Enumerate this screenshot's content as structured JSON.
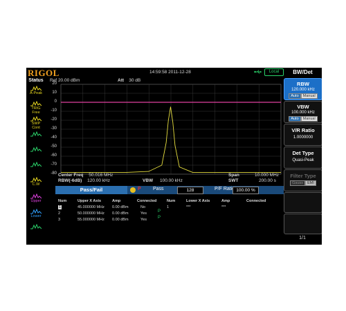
{
  "header": {
    "brand": "RIGOL",
    "clock": "14:59:58 2011-12-28",
    "remote_status": "Local"
  },
  "status": {
    "title": "Status",
    "items": [
      {
        "label": "A-Peak",
        "color": "#e8d820"
      },
      {
        "label": "TRIG",
        "value": "Free",
        "color": "#e8d820"
      },
      {
        "label": "SWP",
        "value": "Cont",
        "color": "#e8d820"
      },
      {
        "label": "",
        "color": "#2ad36a"
      },
      {
        "label": "",
        "color": "#2ad36a"
      },
      {
        "label": "",
        "color": "#2ad36a"
      },
      {
        "label": "C.W",
        "color": "#e8d820"
      },
      {
        "label": "Upper",
        "color": "#e040e0"
      },
      {
        "label": "Lower",
        "color": "#30a0ff"
      },
      {
        "label": "",
        "color": "#2ad36a"
      }
    ]
  },
  "plot": {
    "ref": "Ref",
    "ref_value": "20.00 dBm",
    "att": "Att",
    "att_value": "30 dB",
    "y_ticks": [
      "20",
      "10",
      "0",
      "-10",
      "-20",
      "-30",
      "-40",
      "-50",
      "-60",
      "-70",
      "-80"
    ],
    "upper_limit_color": "#e040a0",
    "trace_color": "#e8e040"
  },
  "chart_data": {
    "type": "line",
    "title": "",
    "xlabel": "",
    "ylabel": "",
    "ylim": [
      -80,
      20
    ],
    "xlim": [
      45.016,
      55.016
    ],
    "x_unit": "MHz",
    "y_unit": "dBm",
    "grid": true,
    "series": [
      {
        "color": "#e8e040",
        "x": [
          45.016,
          46.0,
          47.0,
          48.0,
          49.0,
          49.6,
          49.8,
          49.9,
          50.0,
          50.1,
          50.2,
          50.4,
          51.0,
          52.0,
          53.0,
          54.0,
          55.016
        ],
        "y": [
          -78,
          -78,
          -78,
          -78,
          -77,
          -70,
          -45,
          -20,
          -5,
          -22,
          -48,
          -72,
          -78,
          -78,
          -78,
          -78,
          -78
        ]
      },
      {
        "color": "#e040a0",
        "x": [
          45.016,
          55.016
        ],
        "y": [
          0,
          0
        ]
      }
    ]
  },
  "info": {
    "center_freq_label": "Center Freq",
    "center_freq": "50.016 MHz",
    "rbw_label": "RBW(-6dB)",
    "rbw": "120.00 kHz",
    "vbw_label": "VBW",
    "vbw": "100.00 kHz",
    "span_label": "Span",
    "span": "10.000 MHz",
    "swt_label": "SWT",
    "swt": "200.00 s"
  },
  "passfail": {
    "title": "Pass/Fail",
    "indicator": "P",
    "pass_label": "Pass",
    "pass_count": "128",
    "ratio_label": "P/F Ratio",
    "ratio": "100.00 %",
    "columns_upper": [
      "Num",
      "Upper X Axis",
      "Amp",
      "Connected"
    ],
    "columns_lower": [
      "Num",
      "Lower X Axis",
      "Amp",
      "Connected"
    ],
    "upper_rows": [
      {
        "num": "1",
        "x": "45.000000 MHz",
        "amp": "0.00 dBm",
        "connected": "No"
      },
      {
        "num": "2",
        "x": "50.000000 MHz",
        "amp": "0.00 dBm",
        "connected": "Yes"
      },
      {
        "num": "3",
        "x": "55.000000 MHz",
        "amp": "0.00 dBm",
        "connected": "Yes"
      }
    ],
    "lower_rows": [
      {
        "num": "1",
        "x": "***",
        "amp": "***",
        "connected": ""
      }
    ],
    "p_marks": [
      "P",
      "P"
    ]
  },
  "menu": {
    "title": "BW/Det",
    "rbw": {
      "label": "RBW",
      "value": "120.000 kHz",
      "auto": "Auto",
      "manual": "Manual"
    },
    "vbw": {
      "label": "VBW",
      "value": "100.000 kHz",
      "auto": "Auto",
      "manual": "Manual"
    },
    "vr_ratio": {
      "label": "V/R Ratio",
      "value": "1.0000000"
    },
    "det_type": {
      "label": "Det Type",
      "value": "Quasi-Peak"
    },
    "filter_type": {
      "label": "Filter Type",
      "gauss": "Gauss",
      "emi": "EMI"
    },
    "page": "1/1"
  }
}
